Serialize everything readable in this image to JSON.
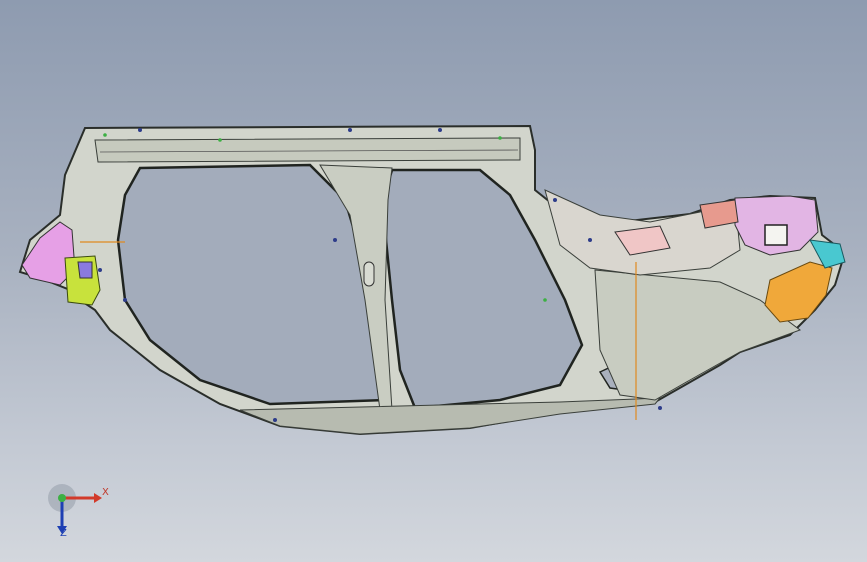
{
  "viewport": {
    "background_top": "#8e9bb0",
    "background_bottom": "#d3d7dd"
  },
  "model": {
    "description_icon": "car-body-side-panel",
    "body_color": "#d2d5cc",
    "edge_color": "#2a2e2a",
    "accent_colors": [
      "#e6a0e6",
      "#c8e23c",
      "#f0a030",
      "#d87c7c",
      "#8a7adf",
      "#49c8d0"
    ]
  },
  "triad": {
    "x_label": "X",
    "y_label": "Z",
    "x_color": "#d23a2a",
    "y_color": "#1d3fb3",
    "origin_color": "#3cb043"
  }
}
